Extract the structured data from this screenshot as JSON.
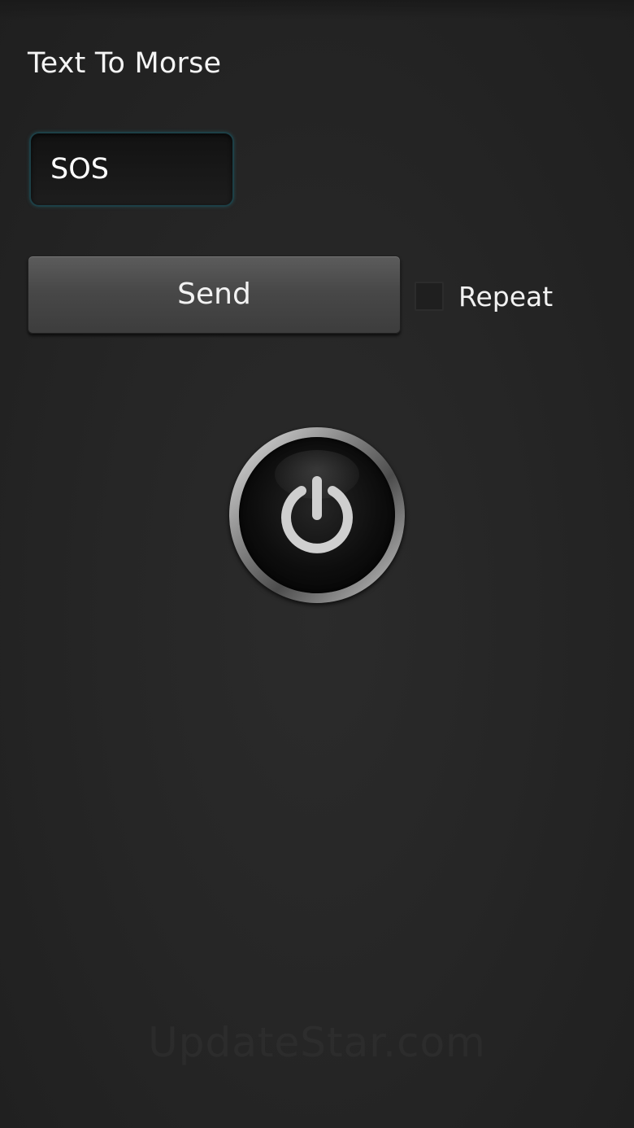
{
  "screen": {
    "title": "Text To Morse"
  },
  "input": {
    "value": "SOS"
  },
  "send_button": {
    "label": "Send"
  },
  "repeat": {
    "label": "Repeat",
    "checked": false
  },
  "power_button": {
    "icon": "power-icon"
  },
  "watermark": {
    "text": "UpdateStar.com"
  },
  "colors": {
    "background": "#262626",
    "input_border": "#1d3f46",
    "button": "#4a4a4a",
    "text": "#f2f2f2"
  }
}
